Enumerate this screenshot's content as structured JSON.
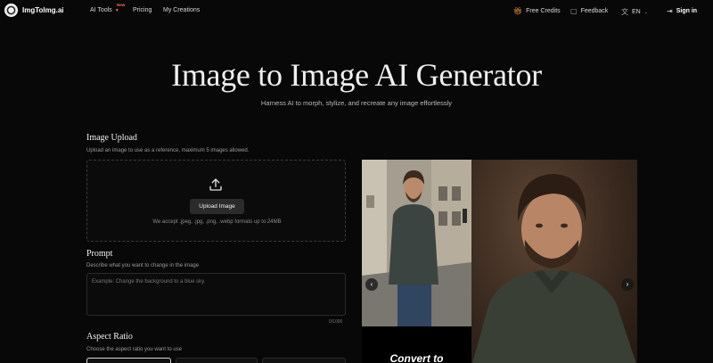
{
  "nav": {
    "brand": "ImgToImg.ai",
    "ai_tools": "AI Tools",
    "new_badge": "New",
    "pricing": "Pricing",
    "my_creations": "My Creations",
    "free_credits": "Free Credits",
    "feedback": "Feedback",
    "language": "EN",
    "sign_in": "Sign in"
  },
  "hero": {
    "title": "Image to Image AI Generator",
    "subtitle": "Harness AI to morph, stylize, and recreate any image effortlessly"
  },
  "upload": {
    "title": "Image Upload",
    "description": "Upload an image to use as a reference, maximum 5 images allowed.",
    "button": "Upload Image",
    "note": "We accept .jpeg, .jpg, .png, .webp formats up to 24MB"
  },
  "prompt": {
    "title": "Prompt",
    "description": "Describe what you want to change in the image",
    "placeholder": "Example: Change the background to a blue sky.",
    "counter": "0/1000"
  },
  "aspect": {
    "title": "Aspect Ratio",
    "description": "Choose the aspect ratio you want to use"
  },
  "preview": {
    "caption": "Convert to"
  },
  "icons": {
    "upload": "upload-icon",
    "gift": "gift-icon",
    "feedback": "feedback-icon",
    "language": "translate-icon",
    "sign_in": "sign-in-icon",
    "prev": "chevron-left-icon",
    "next": "chevron-right-icon"
  }
}
